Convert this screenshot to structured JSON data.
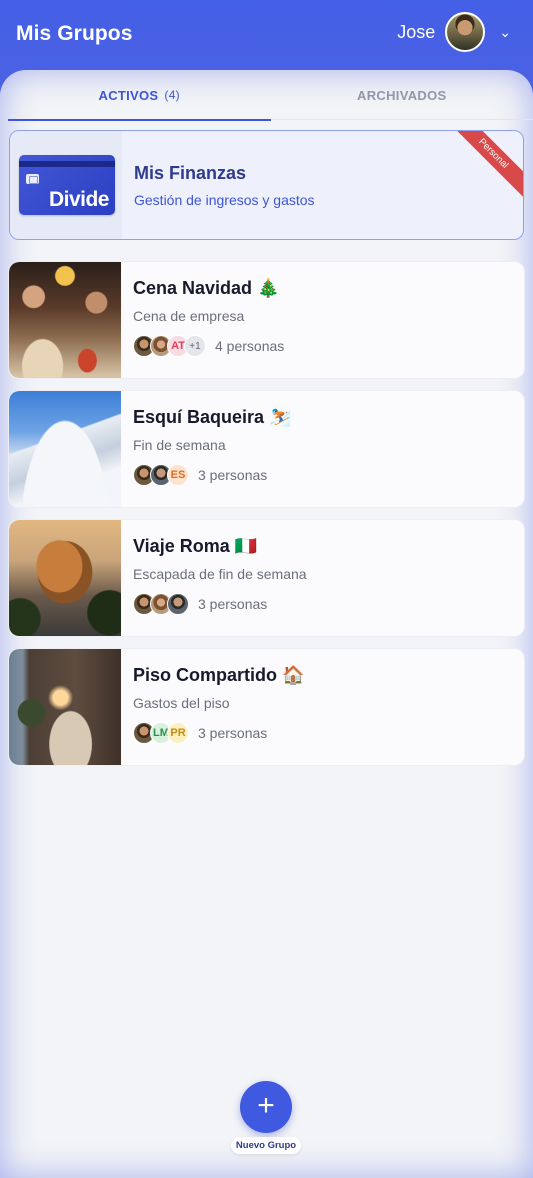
{
  "header": {
    "title": "Mis Grupos",
    "user_name": "Jose",
    "chevron_glyph": "⌄"
  },
  "tabs": [
    {
      "label": "ACTIVOS",
      "count": "(4)",
      "active": true
    },
    {
      "label": "ARCHIVADOS",
      "active": false
    }
  ],
  "finanzas": {
    "title": "Mis Finanzas",
    "subtitle": "Gestión de ingresos y gastos",
    "ribbon": "Personal",
    "card_logo": "Divide"
  },
  "groups": [
    {
      "title": "Cena Navidad 🎄",
      "subtitle": "Cena de empresa",
      "members_text": "4 personas",
      "avatars": [
        "photo",
        "photo",
        "AT",
        "+1"
      ]
    },
    {
      "title": "Esquí Baqueira ⛷️",
      "subtitle": "Fin de semana",
      "members_text": "3 personas",
      "avatars": [
        "photo",
        "photo",
        "ES"
      ]
    },
    {
      "title": "Viaje Roma 🇮🇹",
      "subtitle": "Escapada de fin de semana",
      "members_text": "3 personas",
      "avatars": [
        "photo",
        "photo",
        "photo"
      ]
    },
    {
      "title": "Piso Compartido 🏠",
      "subtitle": "Gastos del piso",
      "members_text": "3 personas",
      "avatars": [
        "photo",
        "LM",
        "PR"
      ]
    }
  ],
  "fab": {
    "icon": "plus-icon",
    "glyph": "+",
    "label": "Nuevo Grupo"
  },
  "colors": {
    "primary": "#3d55d8",
    "header": "#4a5fe0",
    "ribbon": "#d84a4a"
  }
}
